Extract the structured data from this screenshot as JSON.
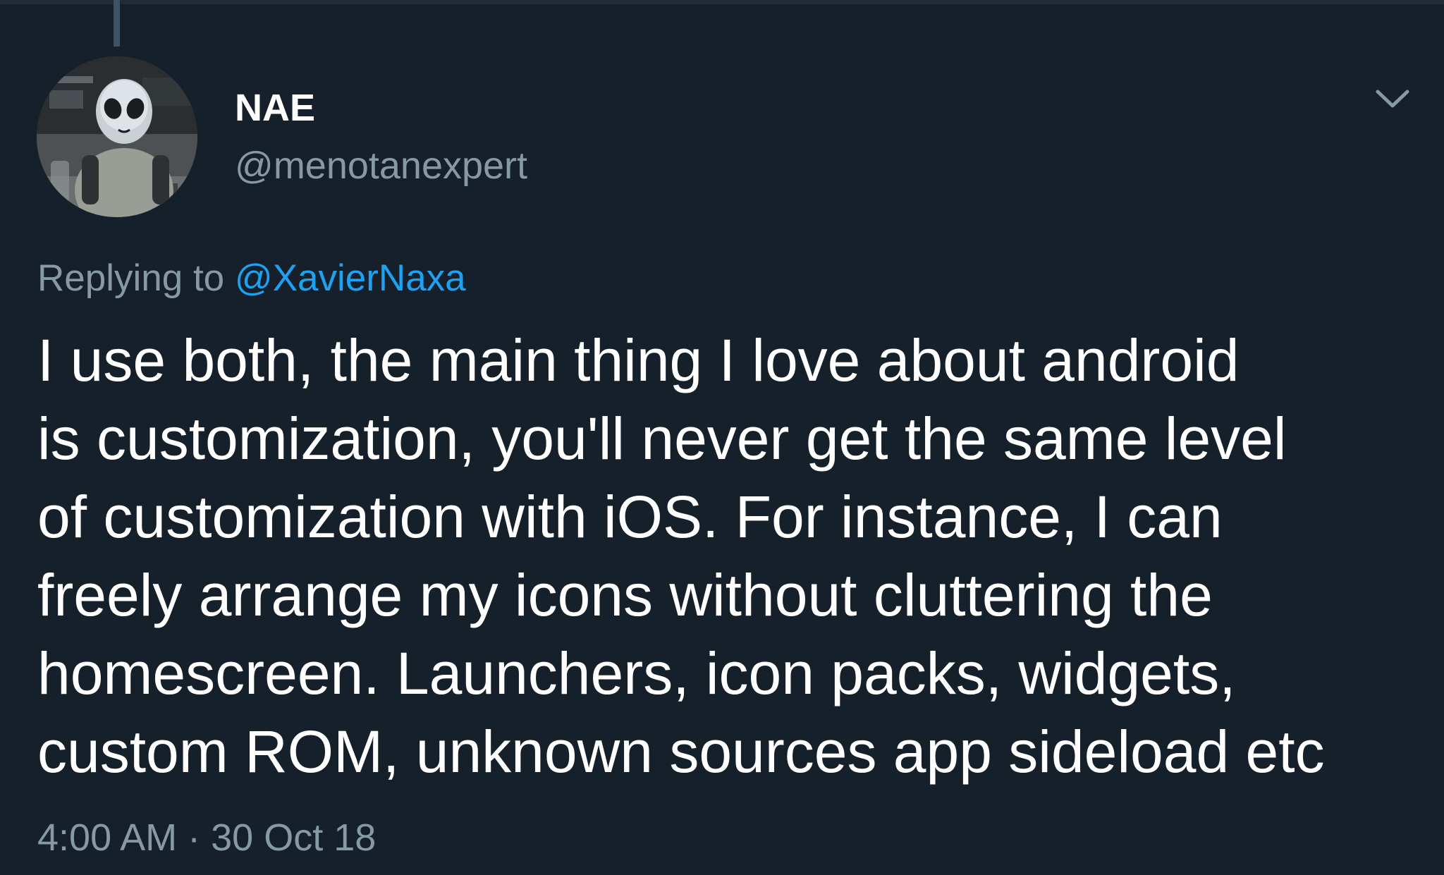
{
  "tweet": {
    "author": {
      "display_name": "NAE",
      "handle": "@menotanexpert",
      "avatar_icon": "alien-face-avatar"
    },
    "reply_context": {
      "prefix": "Replying to",
      "mention": "@XavierNaxa"
    },
    "body": "I use both, the main thing I love about android\nis customization, you'll never get the same level\nof customization with iOS. For instance, I can\nfreely arrange my icons without cluttering the\nhomescreen. Launchers, icon packs, widgets,\ncustom ROM, unknown sources app sideload etc",
    "timestamp": {
      "time": "4:00 AM",
      "separator": "·",
      "date": "30 Oct 18"
    },
    "menu_icon": "chevron-down-icon"
  },
  "colors": {
    "background": "#15202b",
    "text_primary": "#ffffff",
    "text_secondary": "#8899a6",
    "link": "#1da1f2",
    "thread_line": "#3d5466"
  }
}
